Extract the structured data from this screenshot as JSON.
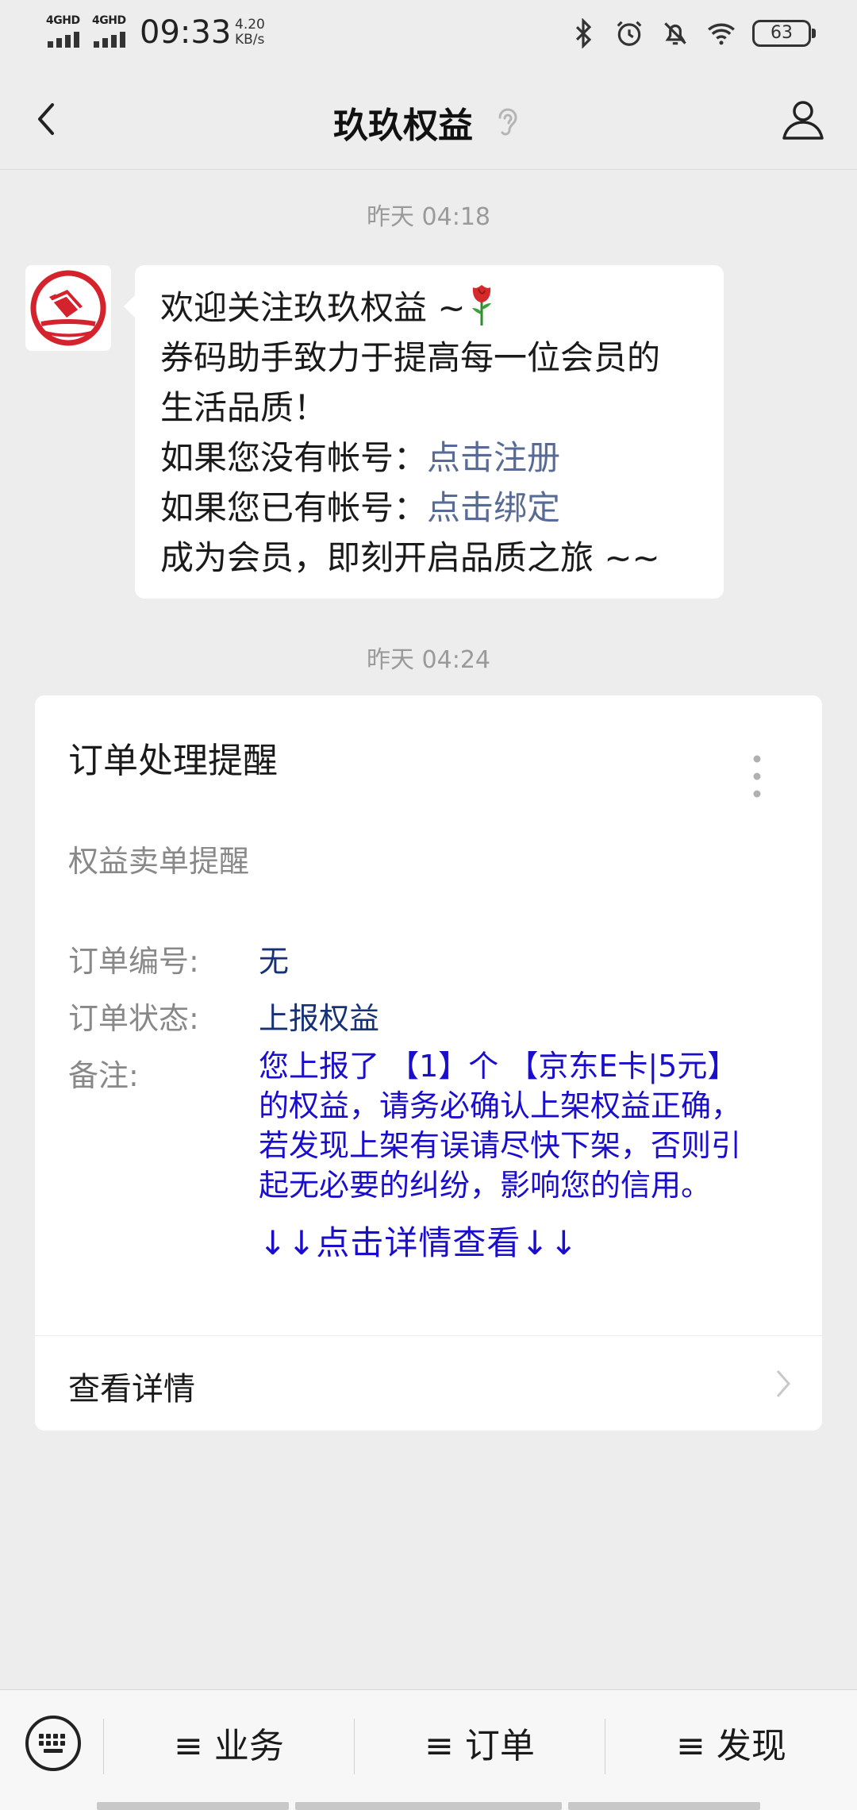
{
  "status_bar": {
    "signal1": "4GHD",
    "signal2": "4GHD",
    "time": "09:33",
    "speed_value": "4.20",
    "speed_unit": "KB/s",
    "battery": "63",
    "icons": [
      "bluetooth-icon",
      "alarm-icon",
      "mute-icon",
      "wifi-icon",
      "battery-icon"
    ]
  },
  "nav": {
    "title": "玖玖权益",
    "back_icon": "back-arrow-icon",
    "ear_icon": "ear-icon",
    "user_icon": "user-profile-icon"
  },
  "chat": {
    "time1": "昨天 04:18",
    "welcome": {
      "line1": "欢迎关注玖玖权益 ~",
      "line2": "券码助手致力于提高每一位会员的",
      "line3": "生活品质！",
      "line4_prefix": "如果您没有帐号：",
      "line4_link": "点击注册",
      "line5_prefix": "如果您已有帐号：",
      "line5_link": "点击绑定",
      "line6": "成为会员，即刻开启品质之旅 ~~"
    },
    "time2": "昨天 04:24"
  },
  "card": {
    "title": "订单处理提醒",
    "subtitle": "权益卖单提醒",
    "order_no_label": "订单编号:",
    "order_no_value": "无",
    "status_label": "订单状态:",
    "status_value": "上报权益",
    "remark_label": "备注:",
    "remark_lines": [
      "您上报了 【1】个 【京东E卡|5元】",
      "的权益，请务必确认上架权益正确，",
      "若发现上架有误请尽快下架，否则引",
      "起无必要的纠纷，影响您的信用。"
    ],
    "detail_hint": "↓↓点击详情查看↓↓",
    "footer_label": "查看详情"
  },
  "bottom_menu": {
    "keyboard_icon": "keyboard-icon",
    "items": [
      "≡ 业务",
      "≡ 订单",
      "≡ 发现"
    ]
  },
  "colors": {
    "background": "#ededed",
    "link": "#576b95",
    "remark_blue": "#1a0dcc",
    "value_navy": "#173177"
  }
}
